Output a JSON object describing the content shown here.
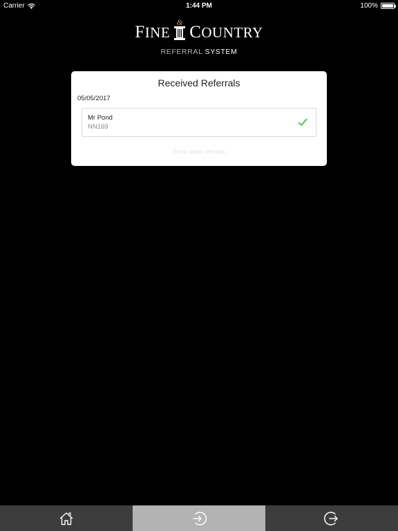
{
  "status_bar": {
    "carrier": "Carrier",
    "time": "1:44 PM",
    "battery": "100%",
    "battery_level": 1.0
  },
  "header": {
    "logo_word_left_initial": "F",
    "logo_word_left_rest": "INE",
    "logo_ampersand": "&",
    "logo_word_right_initial": "C",
    "logo_word_right_rest": "OUNTRY",
    "subtitle_part1": "REFERRAL",
    "subtitle_part2": "SYSTEM"
  },
  "card": {
    "title": "Received Referrals",
    "groups": [
      {
        "date": "05/05/2017",
        "items": [
          {
            "name": "Mr Pond",
            "code": "NN169",
            "status_icon": "checkmark-icon"
          }
        ]
      }
    ],
    "older_link": "Show older referrals"
  },
  "colors": {
    "background": "#000000",
    "check": "#2ecc40",
    "tab_bar": "#3d3d3d",
    "tab_active": "#b3b3b3"
  },
  "tabs": [
    {
      "icon": "home-icon",
      "active": false
    },
    {
      "icon": "received-icon",
      "active": true
    },
    {
      "icon": "sent-icon",
      "active": false
    }
  ]
}
